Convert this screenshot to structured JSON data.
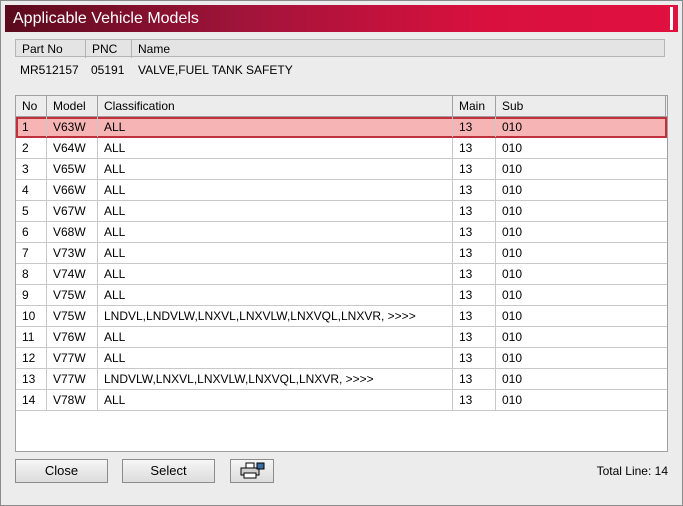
{
  "window": {
    "title": "Applicable Vehicle Models"
  },
  "part_info": {
    "headers": {
      "part_no": "Part No",
      "pnc": "PNC",
      "name": "Name"
    },
    "values": {
      "part_no": "MR512157",
      "pnc": "05191",
      "name": "VALVE,FUEL TANK SAFETY"
    }
  },
  "grid": {
    "headers": {
      "no": "No",
      "model": "Model",
      "classification": "Classification",
      "main": "Main",
      "sub": "Sub"
    },
    "selected_row": 1,
    "rows": [
      {
        "no": "1",
        "model": "V63W",
        "classification": "ALL",
        "main": "13",
        "sub": "010"
      },
      {
        "no": "2",
        "model": "V64W",
        "classification": "ALL",
        "main": "13",
        "sub": "010"
      },
      {
        "no": "3",
        "model": "V65W",
        "classification": "ALL",
        "main": "13",
        "sub": "010"
      },
      {
        "no": "4",
        "model": "V66W",
        "classification": "ALL",
        "main": "13",
        "sub": "010"
      },
      {
        "no": "5",
        "model": "V67W",
        "classification": "ALL",
        "main": "13",
        "sub": "010"
      },
      {
        "no": "6",
        "model": "V68W",
        "classification": "ALL",
        "main": "13",
        "sub": "010"
      },
      {
        "no": "7",
        "model": "V73W",
        "classification": "ALL",
        "main": "13",
        "sub": "010"
      },
      {
        "no": "8",
        "model": "V74W",
        "classification": "ALL",
        "main": "13",
        "sub": "010"
      },
      {
        "no": "9",
        "model": "V75W",
        "classification": "ALL",
        "main": "13",
        "sub": "010"
      },
      {
        "no": "10",
        "model": "V75W",
        "classification": "LNDVL,LNDVLW,LNXVL,LNXVLW,LNXVQL,LNXVR,  >>>>",
        "main": "13",
        "sub": "010"
      },
      {
        "no": "11",
        "model": "V76W",
        "classification": "ALL",
        "main": "13",
        "sub": "010"
      },
      {
        "no": "12",
        "model": "V77W",
        "classification": "ALL",
        "main": "13",
        "sub": "010"
      },
      {
        "no": "13",
        "model": "V77W",
        "classification": "LNDVLW,LNXVL,LNXVLW,LNXVQL,LNXVR,  >>>>",
        "main": "13",
        "sub": "010"
      },
      {
        "no": "14",
        "model": "V78W",
        "classification": "ALL",
        "main": "13",
        "sub": "010"
      }
    ]
  },
  "footer": {
    "close_label": "Close",
    "select_label": "Select",
    "print_icon": "printer-icon",
    "total_text": "Total Line: 14"
  },
  "colors": {
    "title_gradient_start": "#5a0a1c",
    "title_gradient_end": "#e0103f",
    "selection_fill": "#f7b4b4",
    "selection_border": "#c0303a"
  }
}
